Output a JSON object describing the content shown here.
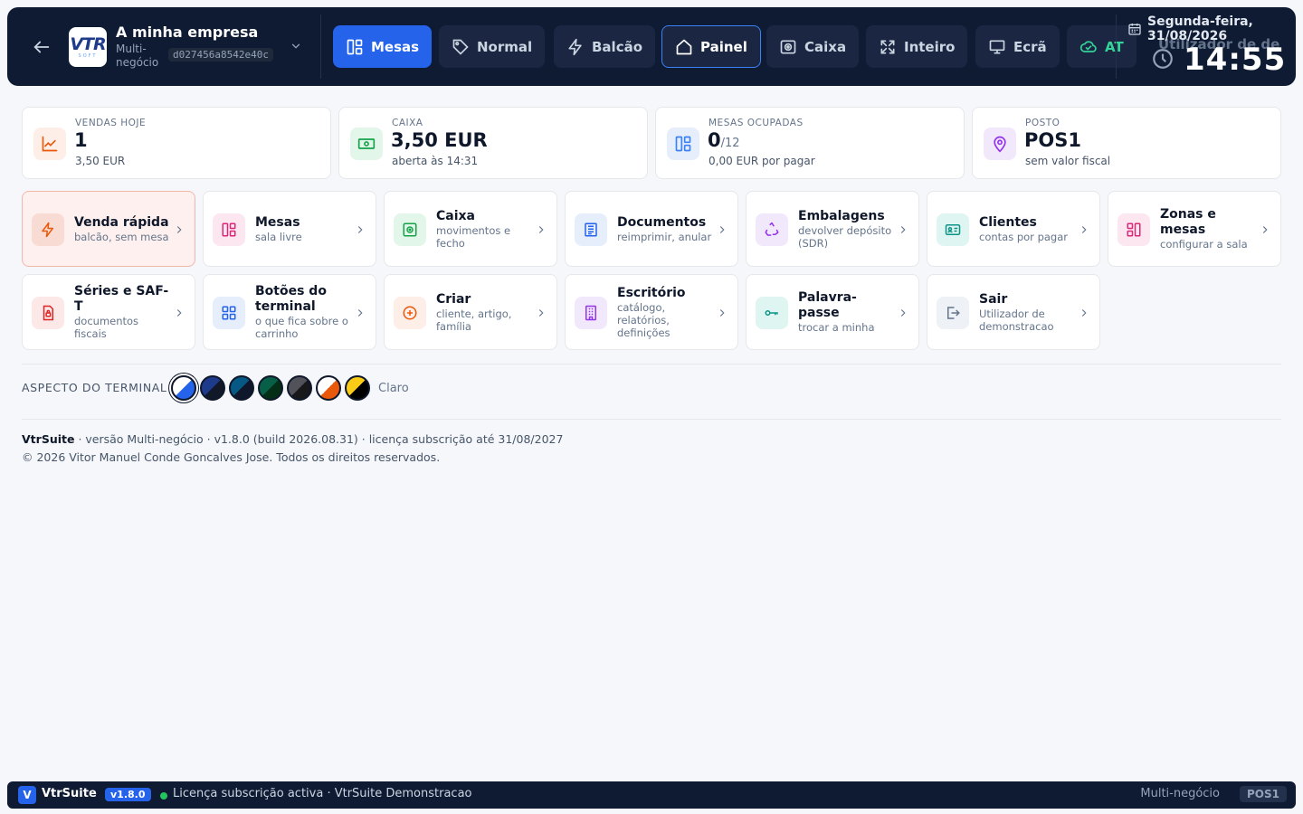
{
  "header": {
    "company_name": "A minha empresa",
    "company_type": "Multi-negócio",
    "company_id": "d027456a8542e40c",
    "nav": [
      {
        "label": "Mesas",
        "icon": "tables-icon"
      },
      {
        "label": "Normal",
        "icon": "tag-icon"
      },
      {
        "label": "Balcão",
        "icon": "bolt-icon"
      },
      {
        "label": "Painel",
        "icon": "home-icon"
      },
      {
        "label": "Caixa",
        "icon": "cash-icon"
      },
      {
        "label": "Inteiro",
        "icon": "expand-icon"
      },
      {
        "label": "Ecrã",
        "icon": "monitor-icon"
      },
      {
        "label": "AT",
        "icon": "cloud-check-icon"
      }
    ],
    "user": "Utilizador de de",
    "date": "Segunda-feira, 31/08/2026",
    "time": "14:55"
  },
  "kpis": [
    {
      "label": "VENDAS HOJE",
      "value": "1",
      "value_small": "",
      "sub": "3,50 EUR",
      "icon": "trend-up-icon",
      "color": "#ea580c",
      "bg": "#fdeee7"
    },
    {
      "label": "CAIXA",
      "value": "3,50 EUR",
      "value_small": "",
      "sub": "aberta às 14:31",
      "icon": "money-icon",
      "color": "#16a34a",
      "bg": "#e3f6ea"
    },
    {
      "label": "MESAS OCUPADAS",
      "value": "0",
      "value_small": "/12",
      "sub": "0,00 EUR por pagar",
      "icon": "tables-icon",
      "color": "#3b82f6",
      "bg": "#e6eefc"
    },
    {
      "label": "POSTO",
      "value": "POS1",
      "value_small": "",
      "sub": "sem valor fiscal",
      "icon": "location-pin-icon",
      "color": "#9333ea",
      "bg": "#f2e8fc"
    }
  ],
  "tiles": [
    {
      "title": "Venda rápida",
      "sub": "balcão, sem mesa",
      "icon": "bolt-icon",
      "color": "#ea580c",
      "bg": "#f8dcd3"
    },
    {
      "title": "Mesas",
      "sub": "sala livre",
      "icon": "tables-icon",
      "color": "#db2777",
      "bg": "#fce7f1"
    },
    {
      "title": "Caixa",
      "sub": "movimentos e fecho",
      "icon": "safe-icon",
      "color": "#16a34a",
      "bg": "#e3f6ea"
    },
    {
      "title": "Documentos",
      "sub": "reimprimir, anular",
      "icon": "document-icon",
      "color": "#2563eb",
      "bg": "#e6eefc"
    },
    {
      "title": "Embalagens",
      "sub": "devolver depósito (SDR)",
      "icon": "recycle-icon",
      "color": "#9333ea",
      "bg": "#f2e8fc"
    },
    {
      "title": "Clientes",
      "sub": "contas por pagar",
      "icon": "id-card-icon",
      "color": "#0d9488",
      "bg": "#dff5f1"
    },
    {
      "title": "Zonas e mesas",
      "sub": "configurar a sala",
      "icon": "layout-icon",
      "color": "#db2777",
      "bg": "#fce7f1"
    },
    {
      "title": "Séries e SAF-T",
      "sub": "documentos fiscais",
      "icon": "file-lock-icon",
      "color": "#dc2626",
      "bg": "#fde8e8"
    },
    {
      "title": "Botões do terminal",
      "sub": "o que fica sobre o carrinho",
      "icon": "grid-icon",
      "color": "#2563eb",
      "bg": "#e6eefc"
    },
    {
      "title": "Criar",
      "sub": "cliente, artigo, família",
      "icon": "plus-circle-icon",
      "color": "#ea580c",
      "bg": "#fdeee7"
    },
    {
      "title": "Escritório",
      "sub": "catálogo, relatórios, definições",
      "icon": "building-icon",
      "color": "#9333ea",
      "bg": "#f2e8fc"
    },
    {
      "title": "Palavra-passe",
      "sub": "trocar a minha",
      "icon": "key-icon",
      "color": "#0d9488",
      "bg": "#dff5f1"
    },
    {
      "title": "Sair",
      "sub": "Utilizador de demonstracao",
      "icon": "logout-icon",
      "color": "#64748b",
      "bg": "#eef1f5"
    }
  ],
  "aspect": {
    "label": "ASPECTO DO TERMINAL",
    "current": "Claro",
    "themes": [
      {
        "a": "#ffffff",
        "b": "#2563eb"
      },
      {
        "a": "#1e3a8a",
        "b": "#111827"
      },
      {
        "a": "#075985",
        "b": "#0f172a"
      },
      {
        "a": "#065f46",
        "b": "#052e16"
      },
      {
        "a": "#52525b",
        "b": "#18181b"
      },
      {
        "a": "#ffffff",
        "b": "#ea580c"
      },
      {
        "a": "#facc15",
        "b": "#000000"
      }
    ]
  },
  "footer": {
    "brand": "VtrSuite",
    "line1": " · versão Multi-negócio · v1.8.0 (build 2026.08.31) · licença subscrição até 31/08/2027",
    "line2": "© 2026 Vitor Manuel Conde Goncalves Jose. Todos os direitos reservados."
  },
  "statusbar": {
    "logo": "V",
    "name": "VtrSuite",
    "version": "v1.8.0",
    "license": "Licença subscrição activa · VtrSuite Demonstracao",
    "mode": "Multi-negócio",
    "pos": "POS1"
  }
}
